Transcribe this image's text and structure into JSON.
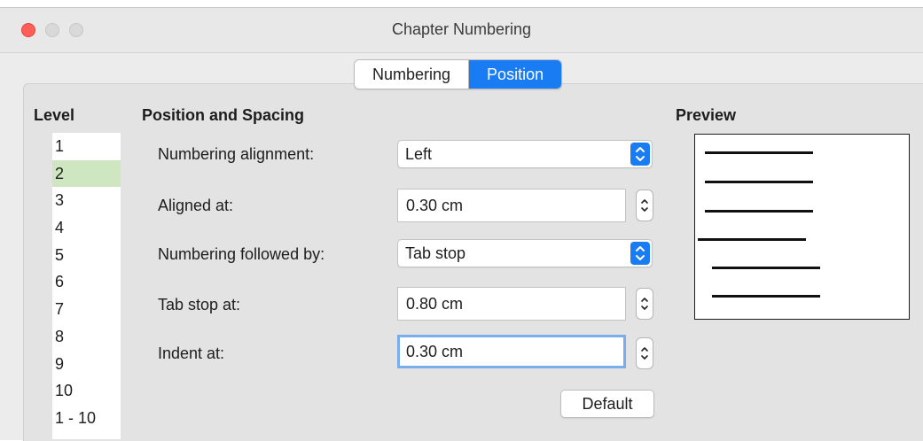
{
  "window": {
    "title": "Chapter Numbering"
  },
  "tabs": [
    {
      "label": "Numbering",
      "active": false
    },
    {
      "label": "Position",
      "active": true
    }
  ],
  "level": {
    "heading": "Level",
    "items": [
      "1",
      "2",
      "3",
      "4",
      "5",
      "6",
      "7",
      "8",
      "9",
      "10",
      "1 - 10"
    ],
    "selected": "2"
  },
  "position": {
    "heading": "Position and Spacing",
    "alignment": {
      "label": "Numbering alignment:",
      "value": "Left"
    },
    "aligned_at": {
      "label": "Aligned at:",
      "value": "0.30 cm"
    },
    "followed_by": {
      "label": "Numbering followed by:",
      "value": "Tab stop"
    },
    "tab_stop_at": {
      "label": "Tab stop at:",
      "value": "0.80 cm"
    },
    "indent_at": {
      "label": "Indent at:",
      "value": "0.30 cm"
    },
    "default_label": "Default"
  },
  "preview": {
    "heading": "Preview"
  },
  "colors": {
    "accent": "#1a7cf3",
    "selection": "#cfe7c0",
    "close": "#ff5f57"
  },
  "icons": {
    "select_arrows": "chevron-up-down-icon",
    "stepper": "stepper-arrows-icon"
  }
}
